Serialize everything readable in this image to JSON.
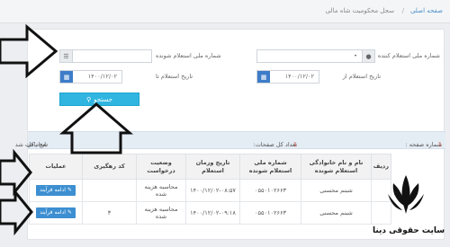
{
  "breadcrumb": {
    "home": "صفحه اصلی",
    "separator": "/",
    "current": "سجل محکومیت شاه مالی"
  },
  "form": {
    "national_id_label": "شماره ملی استعلام کننده",
    "national_id_value": "•",
    "inquired_id_label": "شماره ملی استعلام شونده",
    "inquired_id_value": "",
    "date_from_label": "تاریخ استعلام از",
    "date_from_value": "۱۴۰۰/۱۲/۰۲",
    "date_to_label": "تاریخ استعلام تا",
    "date_to_value": "۱۴۰۰/۱۲/۰۲",
    "search_label": "جستجو"
  },
  "summary": {
    "page_label": "شماره صفحه :",
    "page_value": "1",
    "pages_label": "تعداد کل صفحات:",
    "pages_value": "1",
    "results_label": "تعداد کل ",
    "results_text": "تایج یافت شد"
  },
  "table": {
    "headers": [
      "ردیف",
      "نام و نام خانوادگی استعلام شونده",
      "شماره ملی استعلام شونده",
      "تاریخ وزمان استعلام",
      "وضعیت درخواست",
      "کد رهگیری",
      "عملیات"
    ],
    "rows": [
      {
        "index": "",
        "name": "شبنم محسنی",
        "national_id": "۰۵۵۰۱۰۲۶۶۳",
        "datetime": "۱۴۰۰/۱۲/۰۲-۰۸:۵۷",
        "status": "محاسبه هزینه شده",
        "tracking": "",
        "action": "ادامه فرآیند"
      },
      {
        "index": "",
        "name": "شبنم محسنی",
        "national_id": "۰۵۵۰۱۰۲۶۶۳",
        "datetime": "۱۴۰۰/۱۲/۰۲-۰۹:۱۸",
        "status": "محاسبه هزینه شده",
        "tracking": "۳",
        "action": "ادامه فرآیند"
      }
    ]
  },
  "watermark": {
    "text": "سایت حقوقی دینا"
  },
  "colors": {
    "accent": "#2fb5e0",
    "primary": "#3d8fd1",
    "highlight": "#c0392b"
  },
  "icons": {
    "user": "user-icon",
    "list": "list-icon",
    "calendar": "calendar-icon",
    "search": "search-icon",
    "edit": "pencil-icon"
  }
}
